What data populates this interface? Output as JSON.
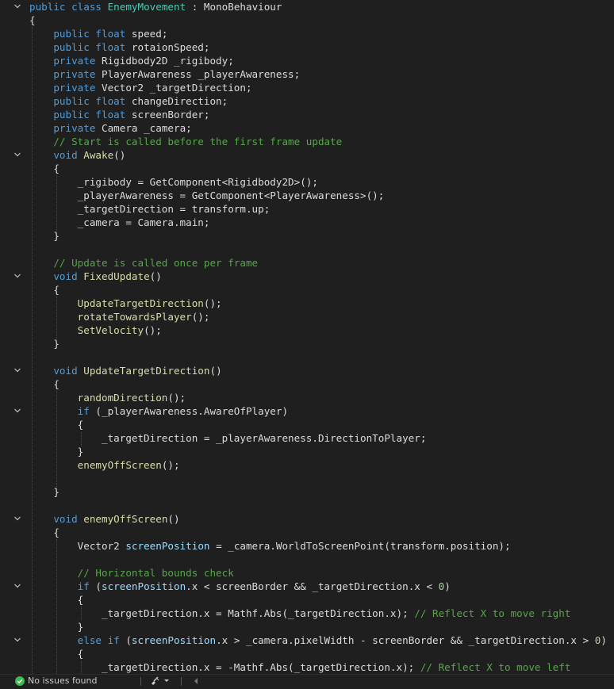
{
  "editor": {
    "lines": [
      [
        [
          "kw",
          "public class "
        ],
        [
          "ty",
          "EnemyMovement"
        ],
        [
          "tx",
          " : "
        ],
        [
          "tx",
          "MonoBehaviour"
        ]
      ],
      [
        [
          "tx",
          "{"
        ]
      ],
      [
        [
          "kw",
          "    public float "
        ],
        [
          "tx",
          "speed;"
        ]
      ],
      [
        [
          "kw",
          "    public float "
        ],
        [
          "tx",
          "rotaionSpeed;"
        ]
      ],
      [
        [
          "kw",
          "    private "
        ],
        [
          "tx",
          "Rigidbody2D _rigibody;"
        ]
      ],
      [
        [
          "kw",
          "    private "
        ],
        [
          "tx",
          "PlayerAwareness _playerAwareness;"
        ]
      ],
      [
        [
          "kw",
          "    private "
        ],
        [
          "tx",
          "Vector2 _targetDirection;"
        ]
      ],
      [
        [
          "kw",
          "    public float "
        ],
        [
          "tx",
          "changeDirection;"
        ]
      ],
      [
        [
          "kw",
          "    public float "
        ],
        [
          "tx",
          "screenBorder;"
        ]
      ],
      [
        [
          "kw",
          "    private "
        ],
        [
          "tx",
          "Camera _camera;"
        ]
      ],
      [
        [
          "cm",
          "    // Start is called before the first frame update"
        ]
      ],
      [
        [
          "kw",
          "    void "
        ],
        [
          "fn",
          "Awake"
        ],
        [
          "tx",
          "()"
        ]
      ],
      [
        [
          "tx",
          "    {"
        ]
      ],
      [
        [
          "tx",
          "        _rigibody = GetComponent<Rigidbody2D>();"
        ]
      ],
      [
        [
          "tx",
          "        _playerAwareness = GetComponent<PlayerAwareness>();"
        ]
      ],
      [
        [
          "tx",
          "        _targetDirection = transform.up;"
        ]
      ],
      [
        [
          "tx",
          "        _camera = Camera.main;"
        ]
      ],
      [
        [
          "tx",
          "    }"
        ]
      ],
      [],
      [
        [
          "cm",
          "    // Update is called once per frame"
        ]
      ],
      [
        [
          "kw",
          "    void "
        ],
        [
          "fn",
          "FixedUpdate"
        ],
        [
          "tx",
          "()"
        ]
      ],
      [
        [
          "tx",
          "    {"
        ]
      ],
      [
        [
          "fn",
          "        UpdateTargetDirection"
        ],
        [
          "tx",
          "();"
        ]
      ],
      [
        [
          "fn",
          "        rotateTowardsPlayer"
        ],
        [
          "tx",
          "();"
        ]
      ],
      [
        [
          "fn",
          "        SetVelocity"
        ],
        [
          "tx",
          "();"
        ]
      ],
      [
        [
          "tx",
          "    }"
        ]
      ],
      [],
      [
        [
          "kw",
          "    void "
        ],
        [
          "fn",
          "UpdateTargetDirection"
        ],
        [
          "tx",
          "()"
        ]
      ],
      [
        [
          "tx",
          "    {"
        ]
      ],
      [
        [
          "fn",
          "        randomDirection"
        ],
        [
          "tx",
          "();"
        ]
      ],
      [
        [
          "kw",
          "        if "
        ],
        [
          "tx",
          "(_playerAwareness.AwareOfPlayer)"
        ]
      ],
      [
        [
          "tx",
          "        {"
        ]
      ],
      [
        [
          "tx",
          "            _targetDirection = _playerAwareness.DirectionToPlayer;"
        ]
      ],
      [
        [
          "tx",
          "        }"
        ]
      ],
      [
        [
          "fn",
          "        enemyOffScreen"
        ],
        [
          "tx",
          "();"
        ]
      ],
      [],
      [
        [
          "tx",
          "    }"
        ]
      ],
      [],
      [
        [
          "kw",
          "    void "
        ],
        [
          "fn",
          "enemyOffScreen"
        ],
        [
          "tx",
          "()"
        ]
      ],
      [
        [
          "tx",
          "    {"
        ]
      ],
      [
        [
          "tx",
          "        Vector2 "
        ],
        [
          "var",
          "screenPosition"
        ],
        [
          "tx",
          " = _camera.WorldToScreenPoint(transform.position);"
        ]
      ],
      [],
      [
        [
          "cm",
          "        // Horizontal bounds check"
        ]
      ],
      [
        [
          "kw",
          "        if "
        ],
        [
          "tx",
          "("
        ],
        [
          "var",
          "screenPosition"
        ],
        [
          "tx",
          ".x < screenBorder && _targetDirection.x < "
        ],
        [
          "nm",
          "0"
        ],
        [
          "tx",
          ")"
        ]
      ],
      [
        [
          "tx",
          "        {"
        ]
      ],
      [
        [
          "tx",
          "            _targetDirection.x = Mathf.Abs(_targetDirection.x); "
        ],
        [
          "cm",
          "// Reflect X to move right"
        ]
      ],
      [
        [
          "tx",
          "        }"
        ]
      ],
      [
        [
          "kw",
          "        else if "
        ],
        [
          "tx",
          "("
        ],
        [
          "var",
          "screenPosition"
        ],
        [
          "tx",
          ".x > _camera.pixelWidth - screenBorder && _targetDirection.x > "
        ],
        [
          "nm",
          "0"
        ],
        [
          "tx",
          ")"
        ]
      ],
      [
        [
          "tx",
          "        {"
        ]
      ],
      [
        [
          "tx",
          "            _targetDirection.x = -Mathf.Abs(_targetDirection.x); "
        ],
        [
          "cm",
          "// Reflect X to move left"
        ]
      ]
    ],
    "fold_lines": [
      0,
      11,
      20,
      27,
      30,
      38,
      43,
      47
    ]
  },
  "statusbar": {
    "status_text": "No issues found",
    "status_icon": "check-circle-icon",
    "status_color": "#3fb950",
    "brush_icon": "code-cleanup-brush-icon",
    "scroll_icon": "scroll-left-arrow-icon"
  }
}
